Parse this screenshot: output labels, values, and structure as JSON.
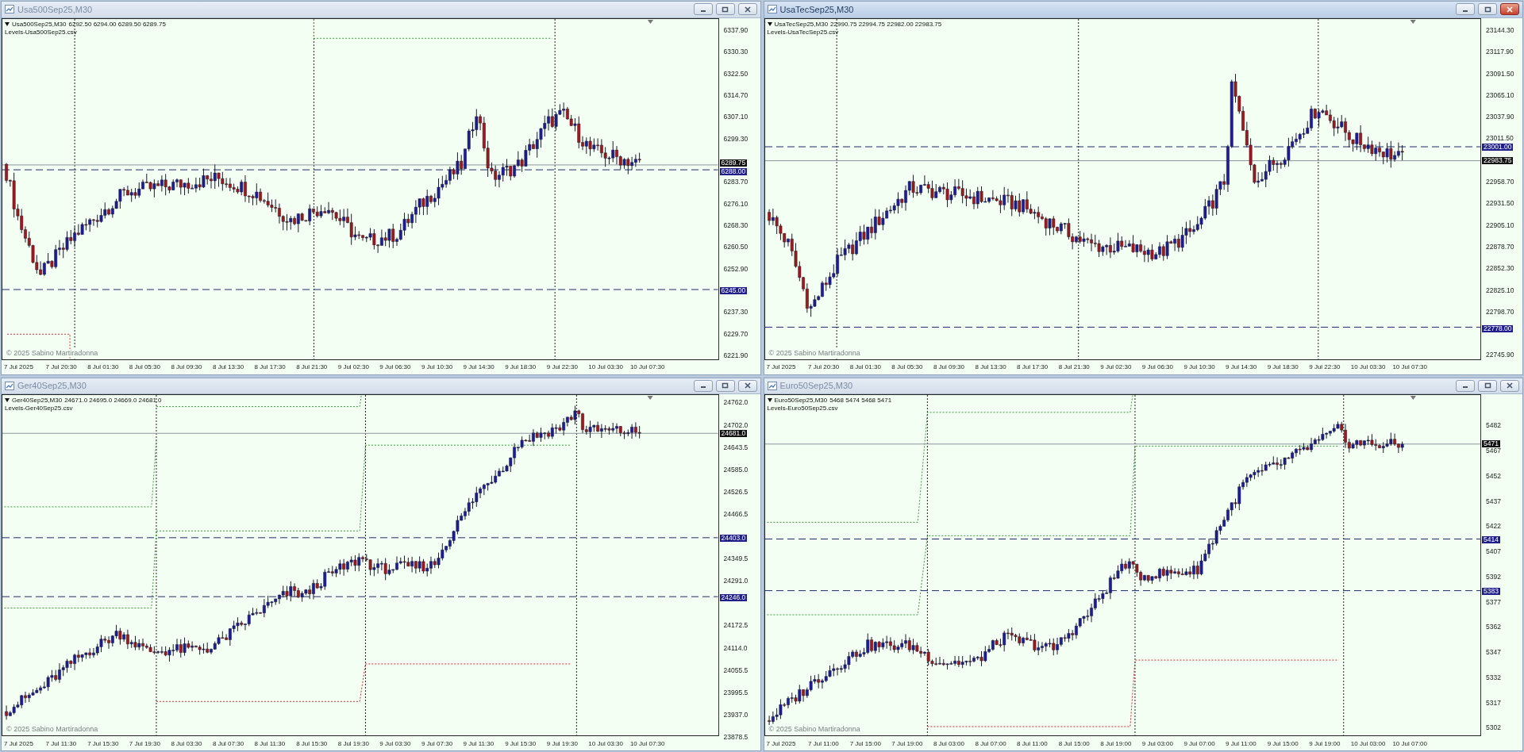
{
  "windows": [
    {
      "title": "Usa500Sep25,M30",
      "active": false,
      "symbol": "Usa500Sep25,M30",
      "quote": "6292.50 6294.00 6289.50 6289.75",
      "levels_file": "Levels-Usa500Sep25.csv",
      "copyright": "© 2025 Sabino Martiradonna",
      "price_labels": [
        "6337.90",
        "6330.30",
        "6322.50",
        "6314.70",
        "6307.10",
        "6299.30",
        "6283.70",
        "6276.10",
        "6268.30",
        "6260.50",
        "6252.90",
        "6237.30",
        "6229.70",
        "6221.90"
      ],
      "tags": [
        {
          "text": "6289.75",
          "kind": "bid"
        },
        {
          "text": "6288.00",
          "kind": "level"
        },
        {
          "text": "6245.00",
          "kind": "level"
        }
      ],
      "time_labels": [
        "7 Jul 2025",
        "7 Jul 20:30",
        "8 Jul 01:30",
        "8 Jul 05:30",
        "8 Jul 09:30",
        "8 Jul 13:30",
        "8 Jul 17:30",
        "8 Jul 21:30",
        "9 Jul 02:30",
        "9 Jul 06:30",
        "9 Jul 10:30",
        "9 Jul 14:30",
        "9 Jul 18:30",
        "9 Jul 22:30",
        "10 Jul 03:30",
        "10 Jul 07:30"
      ]
    },
    {
      "title": "UsaTecSep25,M30",
      "active": true,
      "symbol": "UsaTecSep25,M30",
      "quote": "22990.75 22994.75 22982.00 22983.75",
      "levels_file": "Levels-UsaTecSep25.csv",
      "copyright": "© 2025 Sabino Martiradonna",
      "price_labels": [
        "23144.30",
        "23117.90",
        "23091.50",
        "23065.10",
        "23037.90",
        "23011.50",
        "22958.70",
        "22931.50",
        "22905.10",
        "22878.70",
        "22852.30",
        "22825.10",
        "22798.70",
        "22745.90"
      ],
      "tags": [
        {
          "text": "23001.00",
          "kind": "level"
        },
        {
          "text": "22983.75",
          "kind": "bid"
        },
        {
          "text": "22778.00",
          "kind": "level"
        }
      ],
      "time_labels": [
        "7 Jul 2025",
        "7 Jul 20:30",
        "8 Jul 01:30",
        "8 Jul 05:30",
        "8 Jul 09:30",
        "8 Jul 13:30",
        "8 Jul 17:30",
        "8 Jul 21:30",
        "9 Jul 02:30",
        "9 Jul 06:30",
        "9 Jul 10:30",
        "9 Jul 14:30",
        "9 Jul 18:30",
        "9 Jul 22:30",
        "10 Jul 03:30",
        "10 Jul 07:30"
      ]
    },
    {
      "title": "Ger40Sep25,M30",
      "active": false,
      "symbol": "Ger40Sep25,M30",
      "quote": "24671.0 24695.0 24669.0 24681.0",
      "levels_file": "Levels-Ger40Sep25.csv",
      "copyright": "© 2025 Sabino Martiradonna",
      "price_labels": [
        "24762.0",
        "24702.0",
        "24643.5",
        "24585.0",
        "24526.5",
        "24466.5",
        "24349.5",
        "24291.0",
        "24172.5",
        "24114.0",
        "24055.5",
        "23995.5",
        "23937.0",
        "23878.5"
      ],
      "tags": [
        {
          "text": "24681.0",
          "kind": "bid"
        },
        {
          "text": "24403.0",
          "kind": "level"
        },
        {
          "text": "24246.0",
          "kind": "level"
        }
      ],
      "time_labels": [
        "7 Jul 2025",
        "7 Jul 11:30",
        "7 Jul 15:30",
        "7 Jul 19:30",
        "8 Jul 03:30",
        "8 Jul 07:30",
        "8 Jul 11:30",
        "8 Jul 15:30",
        "8 Jul 19:30",
        "9 Jul 03:30",
        "9 Jul 07:30",
        "9 Jul 11:30",
        "9 Jul 15:30",
        "9 Jul 19:30",
        "10 Jul 03:30",
        "10 Jul 07:30"
      ]
    },
    {
      "title": "Euro50Sep25,M30",
      "active": false,
      "symbol": "Euro50Sep25,M30",
      "quote": "5468 5474 5468 5471",
      "levels_file": "Levels-Euro50Sep25.csv",
      "copyright": "© 2025 Sabino Martiradonna",
      "price_labels": [
        "5482",
        "5467",
        "5452",
        "5437",
        "5422",
        "5407",
        "5392",
        "5377",
        "5362",
        "5347",
        "5332",
        "5317",
        "5302"
      ],
      "tags": [
        {
          "text": "5471",
          "kind": "bid"
        },
        {
          "text": "5414",
          "kind": "level"
        },
        {
          "text": "5383",
          "kind": "level"
        }
      ],
      "time_labels": [
        "7 Jul 2025",
        "7 Jul 11:00",
        "7 Jul 15:00",
        "7 Jul 19:00",
        "8 Jul 03:00",
        "8 Jul 07:00",
        "8 Jul 11:00",
        "8 Jul 15:00",
        "8 Jul 19:00",
        "9 Jul 03:00",
        "9 Jul 07:00",
        "9 Jul 11:00",
        "9 Jul 15:00",
        "9 Jul 19:00",
        "10 Jul 03:00",
        "10 Jul 07:00"
      ]
    }
  ]
}
